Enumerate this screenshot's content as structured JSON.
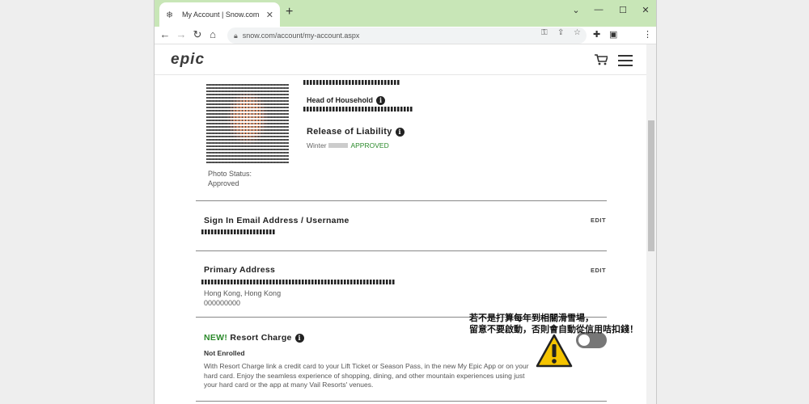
{
  "browser": {
    "tab_title": "My Account | Snow.com",
    "url": "snow.com/account/my-account.aspx"
  },
  "site": {
    "logo": "epic"
  },
  "profile": {
    "photo_status_label": "Photo Status:",
    "photo_status_value": "Approved",
    "head_of_household": "Head of Household",
    "release_title": "Release of Liability",
    "release_season": "Winter",
    "release_status": "APPROVED"
  },
  "sections": {
    "email_title": "Sign In Email Address / Username",
    "address_title": "Primary Address",
    "address_city": "Hong Kong, Hong Kong",
    "address_zip": "000000000",
    "edit_label": "EDIT"
  },
  "resort_charge": {
    "new_label": "NEW!",
    "title": "Resort Charge",
    "status": "Not Enrolled",
    "description": "With Resort Charge link a credit card to your Lift Ticket or Season Pass, in the new My Epic App or on your hard card. Enjoy the seamless experience of shopping, dining, and other mountain experiences using just your hard card or the app at many Vail Resorts' venues.",
    "enabled": false
  },
  "annotation": {
    "line1": "若不是打算每年到相關滑雪場，",
    "line2": "留意不要啟動，否則會自動從信用咭扣錢！"
  },
  "colors": {
    "tabbar": "#c8e6b7",
    "approved": "#2b8a2b",
    "warning": "#f5c400"
  }
}
